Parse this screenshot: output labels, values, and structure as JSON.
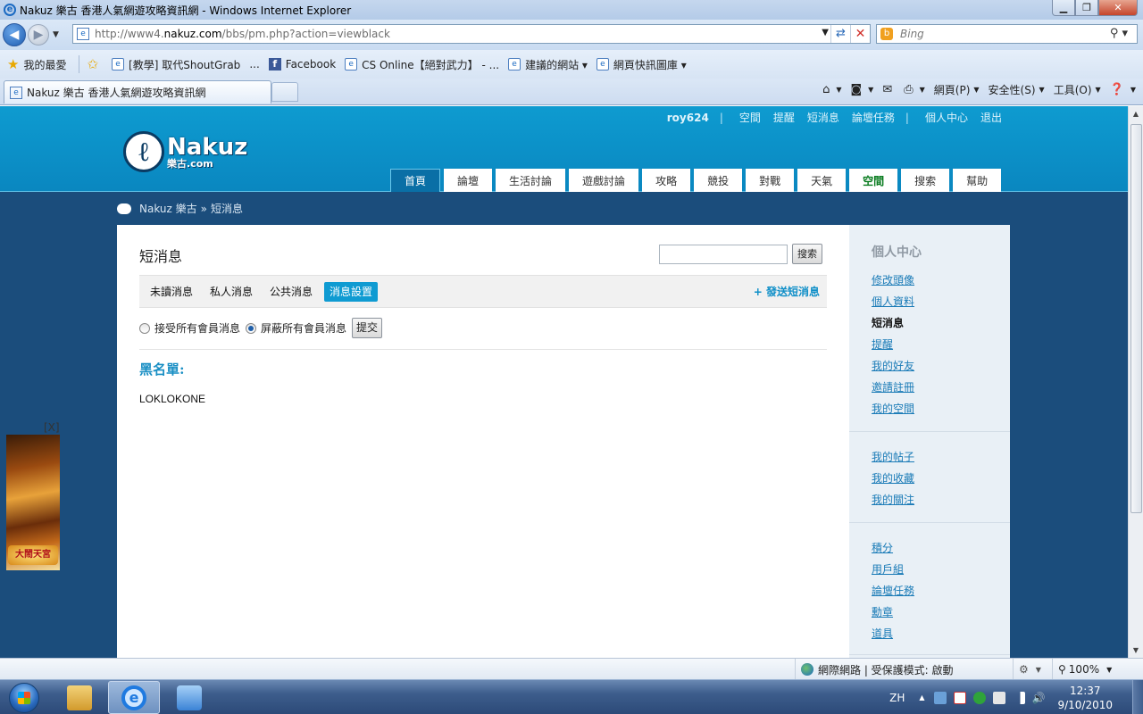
{
  "window": {
    "title": "Nakuz 樂古 香港人氣網遊攻略資訊網 - Windows Internet Explorer",
    "min_glyph": "▁",
    "max_glyph": "❐",
    "close_glyph": "✕"
  },
  "address": {
    "url_prefix": "http://www4.",
    "url_domain": "nakuz.com",
    "url_rest": "/bbs/pm.php?action=viewblack"
  },
  "search": {
    "placeholder": "Bing"
  },
  "favorites": {
    "label": "我的最愛",
    "items": [
      {
        "label": "[教學] 取代ShoutGrab",
        "icon": "ie-page-icon"
      },
      {
        "label": "...",
        "icon": ""
      },
      {
        "label": "Facebook",
        "icon": "facebook-icon"
      },
      {
        "label": "CS Online【絕對武力】 - ...",
        "icon": "ie-page-icon"
      },
      {
        "label": "建議的網站 ▾",
        "icon": "ie-page-icon"
      },
      {
        "label": "網頁快訊圖庫 ▾",
        "icon": "ie-page-icon"
      }
    ]
  },
  "tab": {
    "label": "Nakuz 樂古 香港人氣網遊攻略資訊網"
  },
  "commandbar": {
    "page": "網頁(P)",
    "safety": "安全性(S)",
    "tools": "工具(O)"
  },
  "site": {
    "user": "roy624",
    "toplinks": [
      "空間",
      "提醒",
      "短消息",
      "論壇任務",
      "個人中心",
      "退出"
    ],
    "logo_name": "Nakuz",
    "logo_sub": "樂古.com",
    "nav": [
      "首頁",
      "論壇",
      "生活討論",
      "遊戲討論",
      "攻略",
      "競投",
      "對戰",
      "天氣",
      "空間",
      "搜索",
      "幫助"
    ],
    "breadcrumb_home": "Nakuz 樂古",
    "breadcrumb_sep": "»",
    "breadcrumb_current": "短消息"
  },
  "pm": {
    "title": "短消息",
    "search_button": "搜索",
    "tabs": [
      "未讀消息",
      "私人消息",
      "公共消息",
      "消息設置"
    ],
    "compose": "+ 發送短消息",
    "accept_all": "接受所有會員消息",
    "block_all": "屏蔽所有會員消息",
    "submit": "提交",
    "blacklist_title": "黑名單:",
    "blacklist_entries": [
      "LOKLOKONE"
    ]
  },
  "sidebar": {
    "title": "個人中心",
    "group1": [
      "修改頭像",
      "個人資料",
      "短消息",
      "提醒",
      "我的好友",
      "邀請註冊",
      "我的空間"
    ],
    "group2": [
      "我的帖子",
      "我的收藏",
      "我的關注"
    ],
    "group3": [
      "積分",
      "用戶組",
      "論壇任務",
      "勳章",
      "道具"
    ]
  },
  "ad": {
    "close_label": "[X]",
    "banner_text": "大鬧天宮"
  },
  "statusbar": {
    "zone": "網際網路 | 受保護模式: 啟動",
    "zoom": "100%"
  },
  "taskbar": {
    "lang": "ZH",
    "time": "12:37",
    "date": "9/10/2010"
  }
}
